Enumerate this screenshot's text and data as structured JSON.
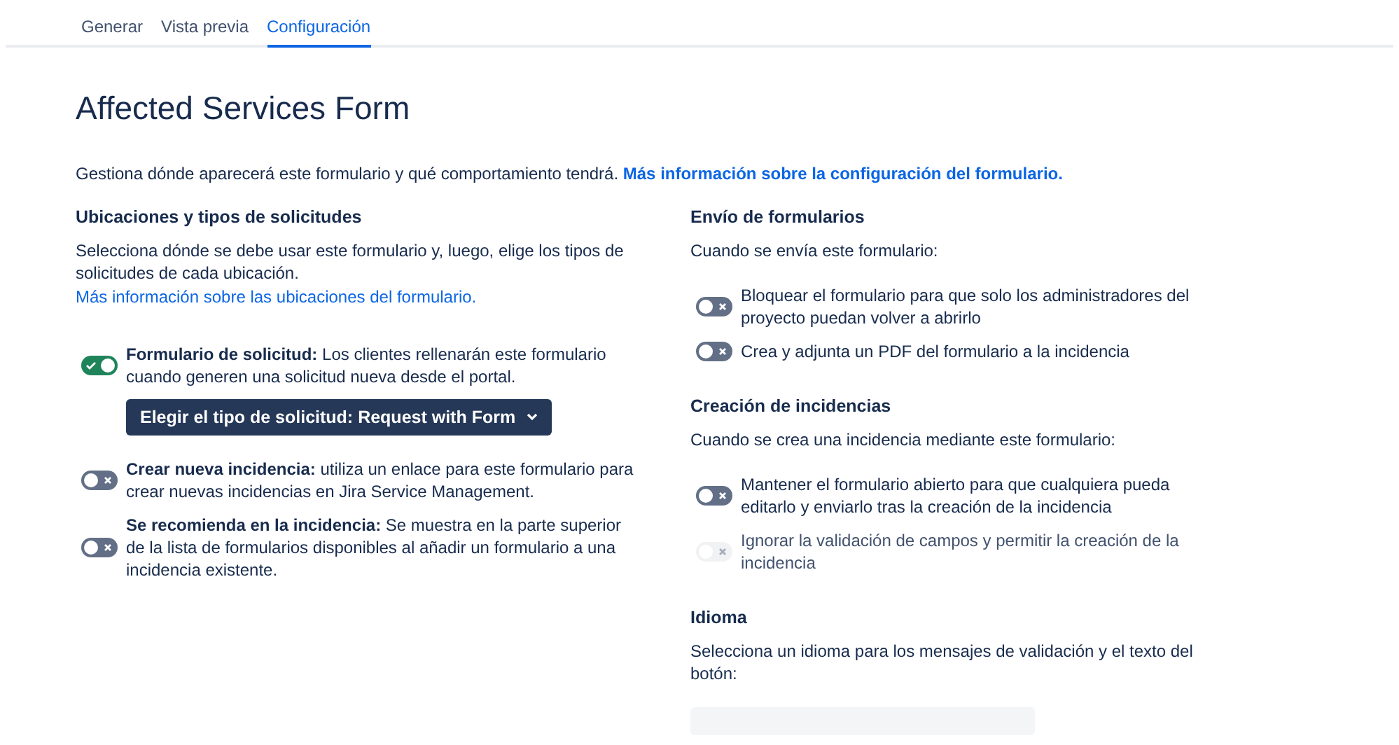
{
  "tabs": [
    {
      "label": "Generar",
      "selected": false
    },
    {
      "label": "Vista previa",
      "selected": false
    },
    {
      "label": "Configuración",
      "selected": true
    }
  ],
  "title": "Affected Services Form",
  "intro": {
    "text": "Gestiona dónde aparecerá este formulario y qué comportamiento tendrá.",
    "link": "Más información sobre la configuración del formulario."
  },
  "left": {
    "heading": "Ubicaciones y tipos de solicitudes",
    "description": "Selecciona dónde se debe usar este formulario y, luego, elige los tipos de solicitudes de cada ubicación.",
    "link": "Más información sobre las ubicaciones del formulario.",
    "options": [
      {
        "label": "**Formulario de solicitud:** Los clientes rellenarán este formulario cuando generen una solicitud nueva desde el portal.",
        "on": true,
        "disabled": false,
        "dropdown": "Elegir el tipo de solicitud: Request with Form"
      },
      {
        "label": "**Crear nueva incidencia:** utiliza un enlace para este formulario para crear nuevas incidencias en Jira Service Management.",
        "on": false,
        "disabled": false
      },
      {
        "label": "**Se recomienda en la incidencia:** Se muestra en la parte superior de la lista de formularios disponibles al añadir un formulario a una incidencia existente.",
        "on": false,
        "disabled": false
      }
    ]
  },
  "right": [
    {
      "heading": "Envío de formularios",
      "description": "Cuando se envía este formulario:",
      "options": [
        {
          "label": "Bloquear el formulario para que solo los administradores del proyecto puedan volver a abrirlo",
          "on": false,
          "disabled": false
        },
        {
          "label": "Crea y adjunta un PDF del formulario a la incidencia",
          "on": false,
          "disabled": false
        }
      ]
    },
    {
      "heading": "Creación de incidencias",
      "description": "Cuando se crea una incidencia mediante este formulario:",
      "options": [
        {
          "label": "Mantener el formulario abierto para que cualquiera pueda editarlo y enviarlo tras la creación de la incidencia",
          "on": false,
          "disabled": false
        },
        {
          "label": "Ignorar la validación de campos y permitir la creación de la incidencia",
          "on": false,
          "disabled": true
        }
      ]
    },
    {
      "heading": "Idioma",
      "description": "Selecciona un idioma para los mensajes de validación y el texto del botón:",
      "select": true
    }
  ]
}
